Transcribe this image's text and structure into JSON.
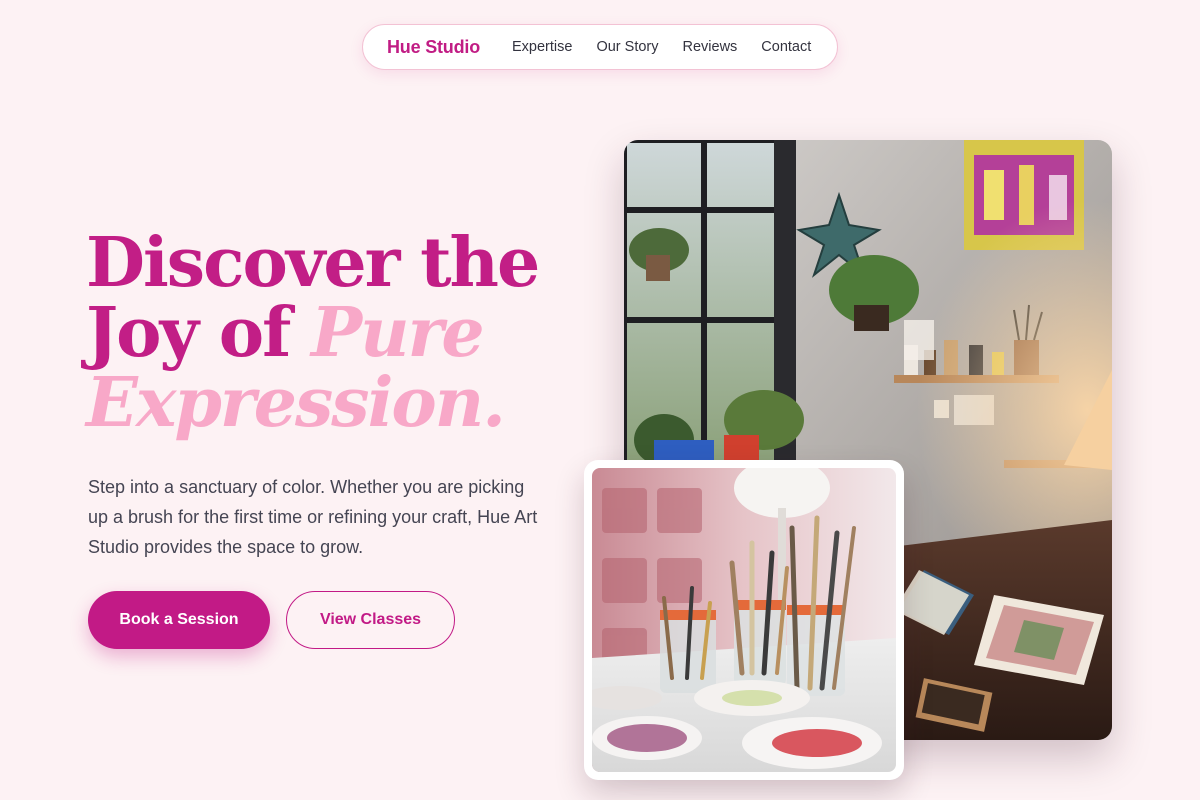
{
  "nav": {
    "brand": "Hue Studio",
    "links": [
      "Expertise",
      "Our Story",
      "Reviews",
      "Contact"
    ]
  },
  "hero": {
    "title_line1": "Discover the",
    "title_line2_a": "Joy of ",
    "title_line2_b": "Pure",
    "title_line3": "Expression.",
    "description": "Step into a sanctuary of color. Whether you are picking up a brush for the first time or refining your craft, Hue Art Studio provides the space to grow.",
    "primary_cta": "Book a Session",
    "secondary_cta": "View Classes"
  },
  "colors": {
    "accent": "#c21a86",
    "accent_light": "#f8a8c8",
    "background": "#fdf2f4"
  }
}
